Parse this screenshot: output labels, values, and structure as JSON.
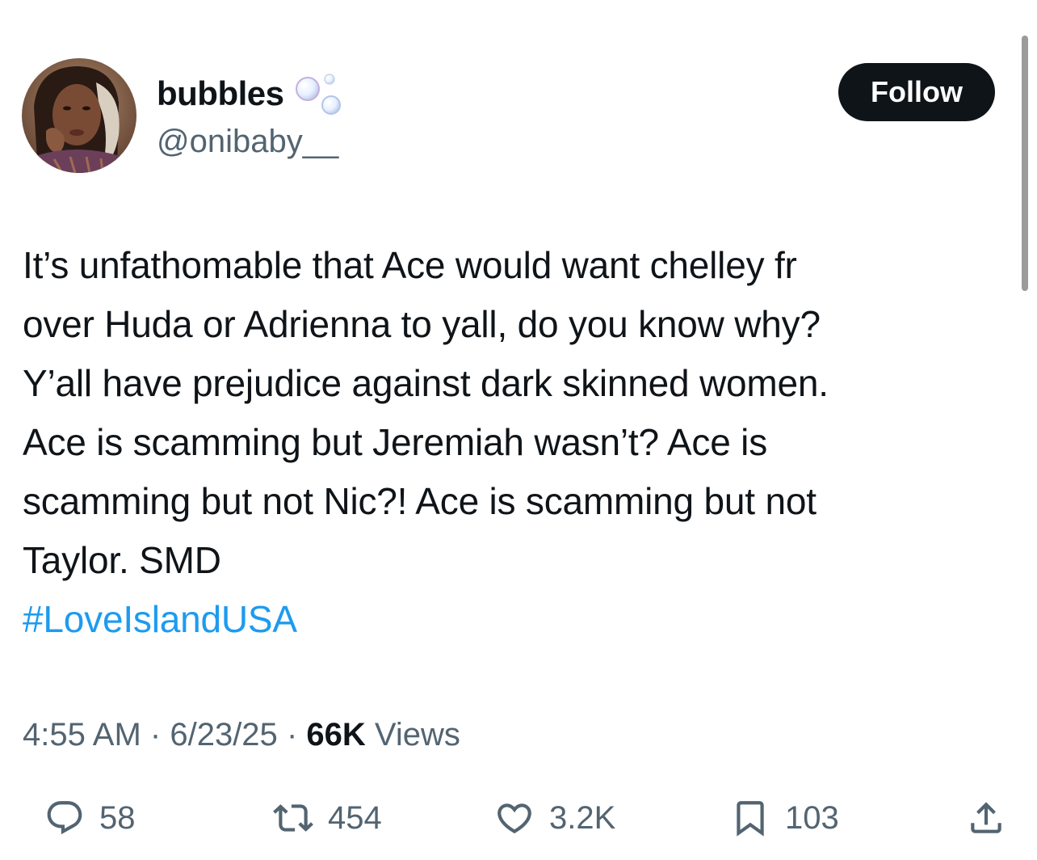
{
  "author": {
    "display_name": "bubbles",
    "name_emoji": "bubbles-emoji",
    "handle": "@onibaby__"
  },
  "follow_label": "Follow",
  "tweet": {
    "lines": [
      "It’s unfathomable that Ace would want chelley fr",
      "over Huda or Adrienna to yall, do you know why?",
      "Y’all have prejudice against dark skinned women.",
      "Ace is scamming but Jeremiah wasn’t? Ace is",
      "scamming but not Nic?! Ace is scamming but not",
      "Taylor. SMD"
    ],
    "hashtag": "#LoveIslandUSA"
  },
  "meta": {
    "time": "4:55 AM",
    "separator": "·",
    "date": "6/23/25",
    "views_count": "66K",
    "views_label": "Views"
  },
  "actions": {
    "replies": "58",
    "reposts": "454",
    "likes": "3.2K",
    "bookmarks": "103"
  },
  "icons": {
    "reply": "reply-icon",
    "repost": "repost-icon",
    "like": "heart-icon",
    "bookmark": "bookmark-icon",
    "share": "share-icon"
  },
  "colors": {
    "text": "#0f1419",
    "secondary": "#536471",
    "link": "#1d9bf0",
    "follow_bg": "#0f1419"
  }
}
